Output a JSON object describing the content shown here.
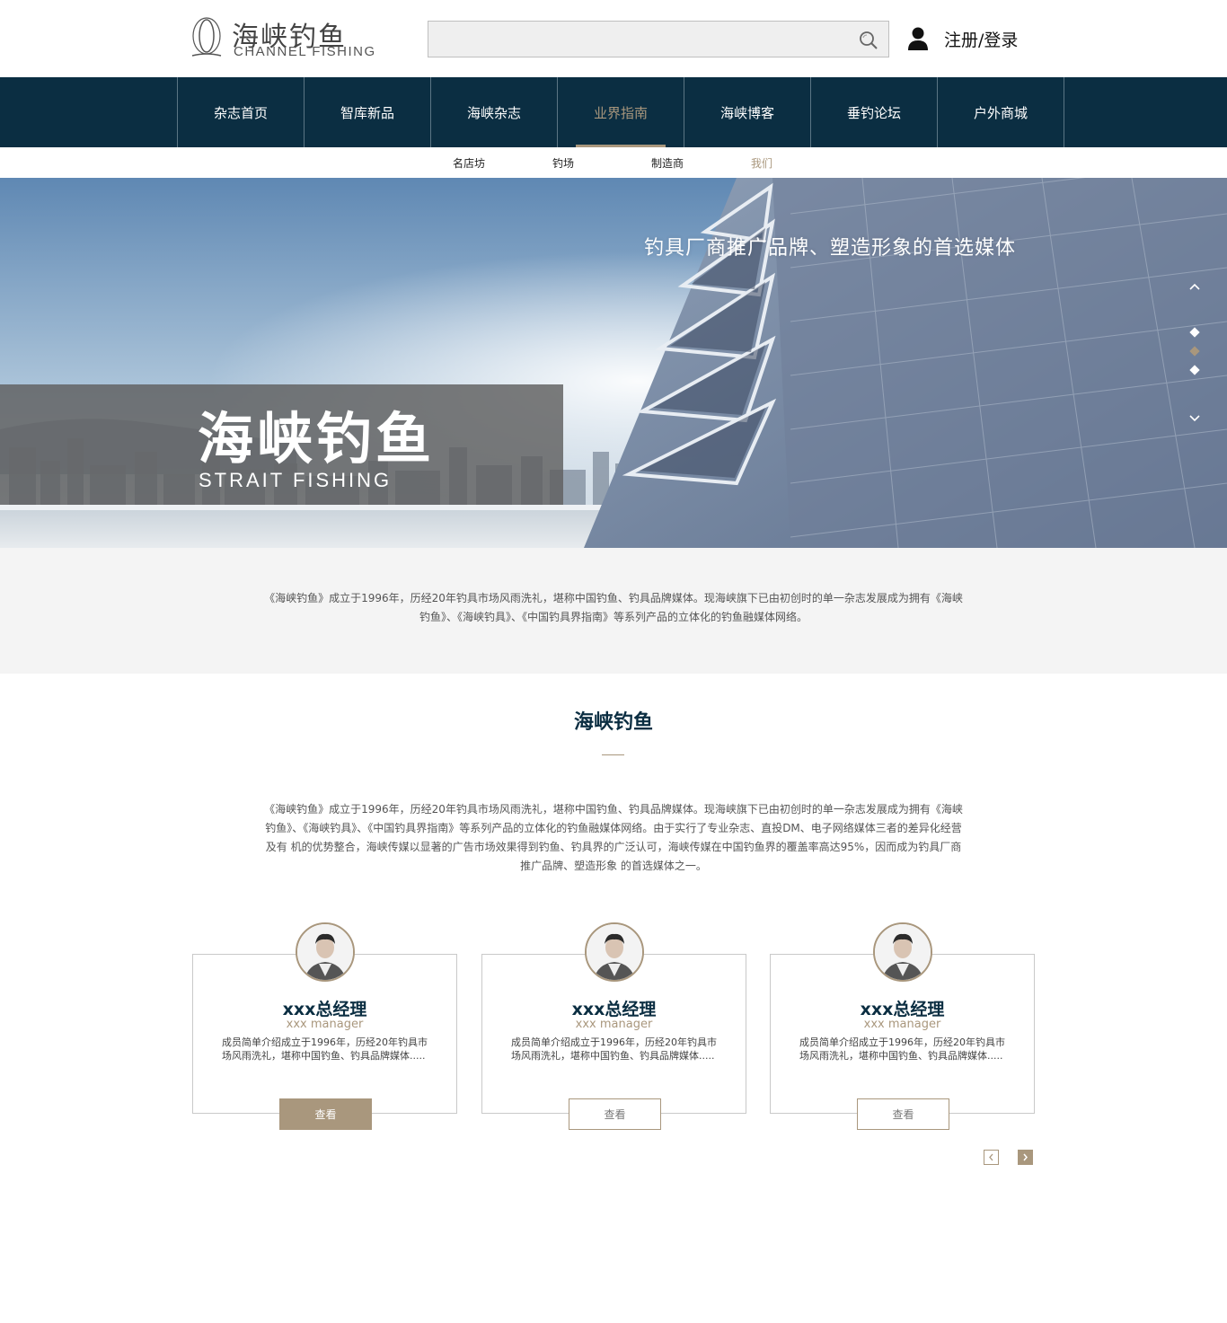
{
  "header": {
    "logo_cn": "海峡钓鱼",
    "logo_en": "CHANNEL FISHING",
    "search": {
      "value": "",
      "placeholder": ""
    },
    "login_label": "注册/登录"
  },
  "nav": {
    "items": [
      {
        "label": "杂志首页"
      },
      {
        "label": "智库新品"
      },
      {
        "label": "海峡杂志"
      },
      {
        "label": "业界指南",
        "active": true
      },
      {
        "label": "海峡博客"
      },
      {
        "label": "垂钓论坛"
      },
      {
        "label": "户外商城"
      }
    ]
  },
  "subnav": {
    "items": [
      {
        "label": "名店坊"
      },
      {
        "label": "钓场"
      },
      {
        "label": "制造商"
      },
      {
        "label": "我们",
        "active": true
      }
    ]
  },
  "banner": {
    "slogan": "钓具厂商推广品牌、塑造形象的首选媒体",
    "title": "海峡钓鱼",
    "subtitle": "STRAIT FISHING",
    "active_dot": 2
  },
  "intro": {
    "text": "《海峡钓鱼》成立于1996年，历经20年钓具市场风雨洗礼，堪称中国钓鱼、钓具品牌媒体。现海峡旗下已由初创时的单一杂志发展成为拥有《海峡钓鱼》、《海峡钓具》、《中国钓具界指南》等系列产品的立体化的钓鱼融媒体网络。"
  },
  "about": {
    "title": "海峡钓鱼",
    "text": "《海峡钓鱼》成立于1996年，历经20年钓具市场风雨洗礼，堪称中国钓鱼、钓具品牌媒体。现海峡旗下已由初创时的单一杂志发展成为拥有《海峡钓鱼》、《海峡钓具》、《中国钓具界指南》等系列产品的立体化的钓鱼融媒体网络。由于实行了专业杂志、直投DM、电子网络媒体三者的差异化经营及有 机的优势整合，海峡传媒以显著的广告市场效果得到钓鱼、钓具界的广泛认可，海峡传媒在中国钓鱼界的覆盖率高达95%，因而成为钓具厂商推广品牌、塑造形象 的首选媒体之一。"
  },
  "team": {
    "members": [
      {
        "name": "xxx总经理",
        "role": "xxx manager",
        "desc": "成员简单介绍成立于1996年，历经20年钓具市场风雨洗礼，堪称中国钓鱼、钓具品牌媒体.....",
        "button": "查看",
        "active": true
      },
      {
        "name": "xxx总经理",
        "role": "xxx manager",
        "desc": "成员简单介绍成立于1996年，历经20年钓具市场风雨洗礼，堪称中国钓鱼、钓具品牌媒体.....",
        "button": "查看"
      },
      {
        "name": "xxx总经理",
        "role": "xxx manager",
        "desc": "成员简单介绍成立于1996年，历经20年钓具市场风雨洗礼，堪称中国钓鱼、钓具品牌媒体.....",
        "button": "查看"
      }
    ]
  },
  "colors": {
    "nav_bg": "#0b2e42",
    "accent": "#a9977d",
    "band_bg": "#f4f4f4"
  },
  "icons": {
    "search": "search-icon",
    "user": "user-icon",
    "up": "chevron-up-icon",
    "down": "chevron-down-icon",
    "prev": "chevron-left-icon",
    "next": "chevron-right-icon"
  }
}
